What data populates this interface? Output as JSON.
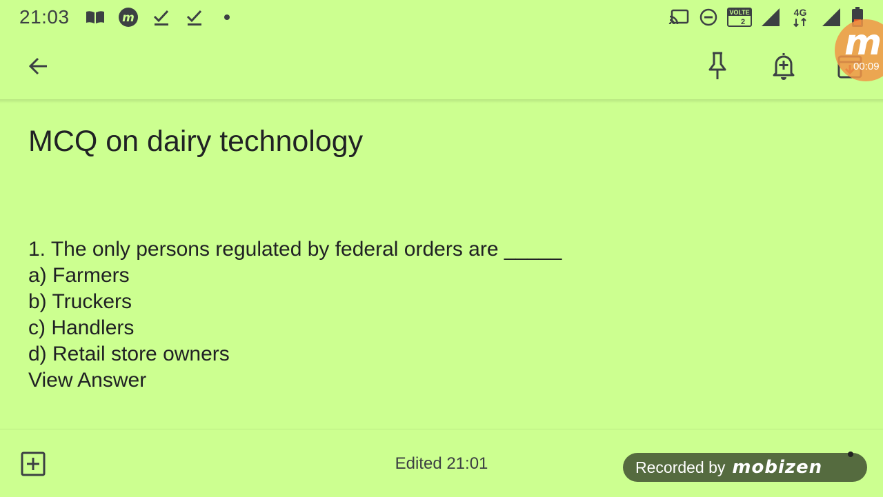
{
  "status_bar": {
    "time": "21:03",
    "left_icons": [
      "book-icon",
      "mobizen-icon",
      "check-icon",
      "check-icon",
      "dot-icon"
    ],
    "right_icons": [
      "cast-icon",
      "dnd-icon",
      "volte-icon",
      "signal-icon",
      "4g-icon",
      "signal-icon",
      "battery-icon"
    ],
    "volte_label": "VOLTE",
    "volte_sim": "2",
    "network_label": "4G"
  },
  "app_bar": {
    "back_icon": "arrow-left-icon",
    "pin_icon": "pin-icon",
    "reminder_icon": "add-alert-icon",
    "archive_icon": "archive-icon"
  },
  "note": {
    "title": "MCQ on dairy technology",
    "lines": [
      "1. The only persons regulated by federal orders are _____",
      "a) Farmers",
      "b) Truckers",
      "c) Handlers",
      "d) Retail store owners",
      "View Answer"
    ]
  },
  "bottom_bar": {
    "add_icon": "add-box-icon",
    "edited_text": "Edited 21:01"
  },
  "overlay": {
    "recorded_by": "Recorded by",
    "recorder_logo": "mobizen",
    "bubble_letter": "m",
    "timer": "00:09"
  },
  "colors": {
    "note_background": "#ccff90",
    "text": "#202124",
    "recorder_badge": "#556b3f",
    "bubble": "#f09646"
  }
}
